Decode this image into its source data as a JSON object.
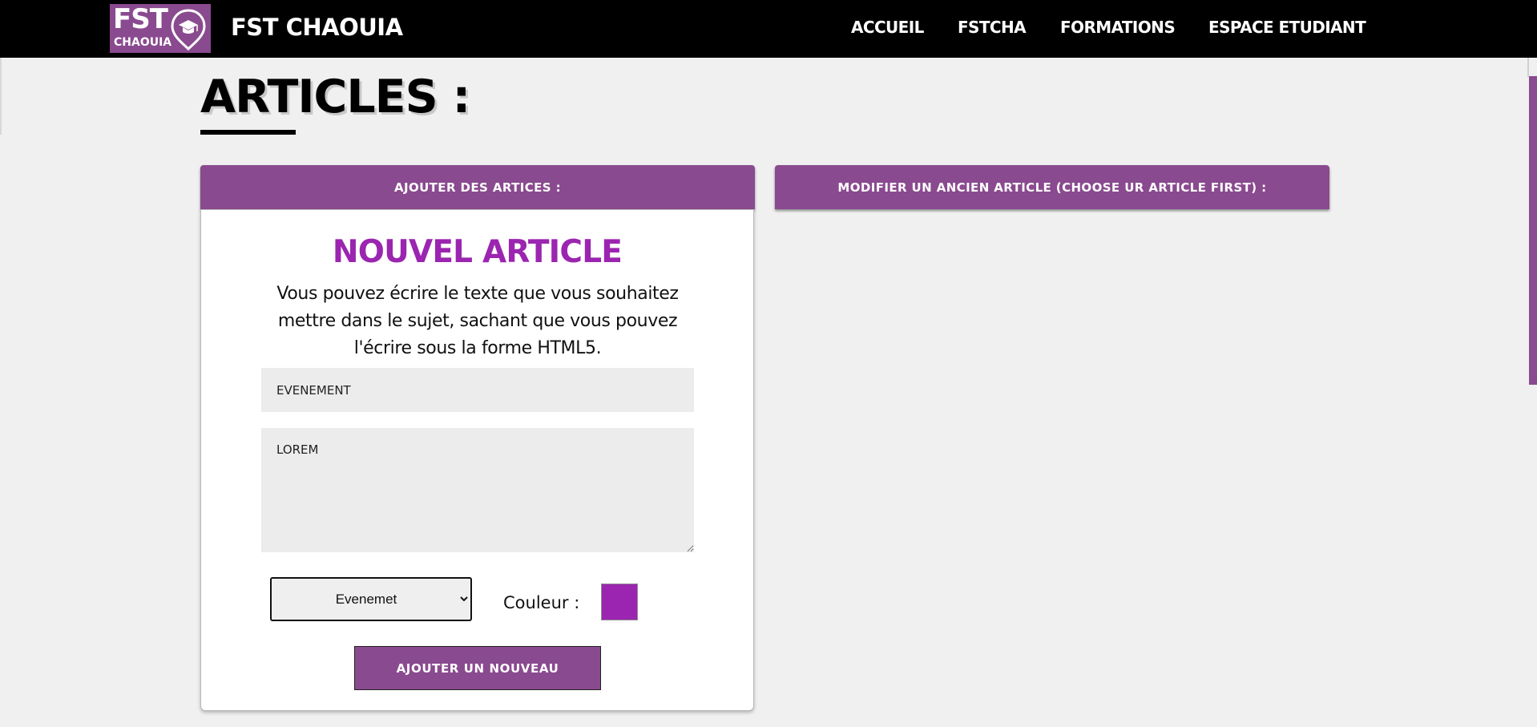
{
  "brand": {
    "logo_line1": "FST",
    "logo_line2": "CHAOUIA",
    "name": "FST CHAOUIA"
  },
  "nav": {
    "items": [
      {
        "label": "ACCUEIL"
      },
      {
        "label": "FSTCHA"
      },
      {
        "label": "FORMATIONS"
      },
      {
        "label": "ESPACE ETUDIANT"
      }
    ]
  },
  "page": {
    "title": "ARTICLES :"
  },
  "tabs": {
    "add_label": "AJOUTER DES ARTICES :",
    "edit_label": "MODIFIER UN ANCIEN ARTICLE (CHOOSE UR ARTICLE FIRST) :"
  },
  "form": {
    "heading": "NOUVEL ARTICLE",
    "description": "Vous pouvez écrire le texte que vous souhaitez mettre dans le sujet, sachant que vous pouvez l'écrire sous la forme HTML5.",
    "title_value": "EVENEMENT",
    "body_value": "LOREM",
    "category_selected": "Evenemet",
    "color_label": "Couleur :",
    "color_value": "#9b25b0",
    "submit_label": "AJOUTER UN NOUVEAU"
  },
  "icons": {
    "logo_pin": "graduation-cap-location-pin-icon",
    "select_arrow": "chevron-down-icon"
  },
  "colors": {
    "brand_purple": "#8a4a8f",
    "heading_purple": "#9b25b0",
    "navbar": "#000000",
    "background": "#f0f0f0"
  }
}
